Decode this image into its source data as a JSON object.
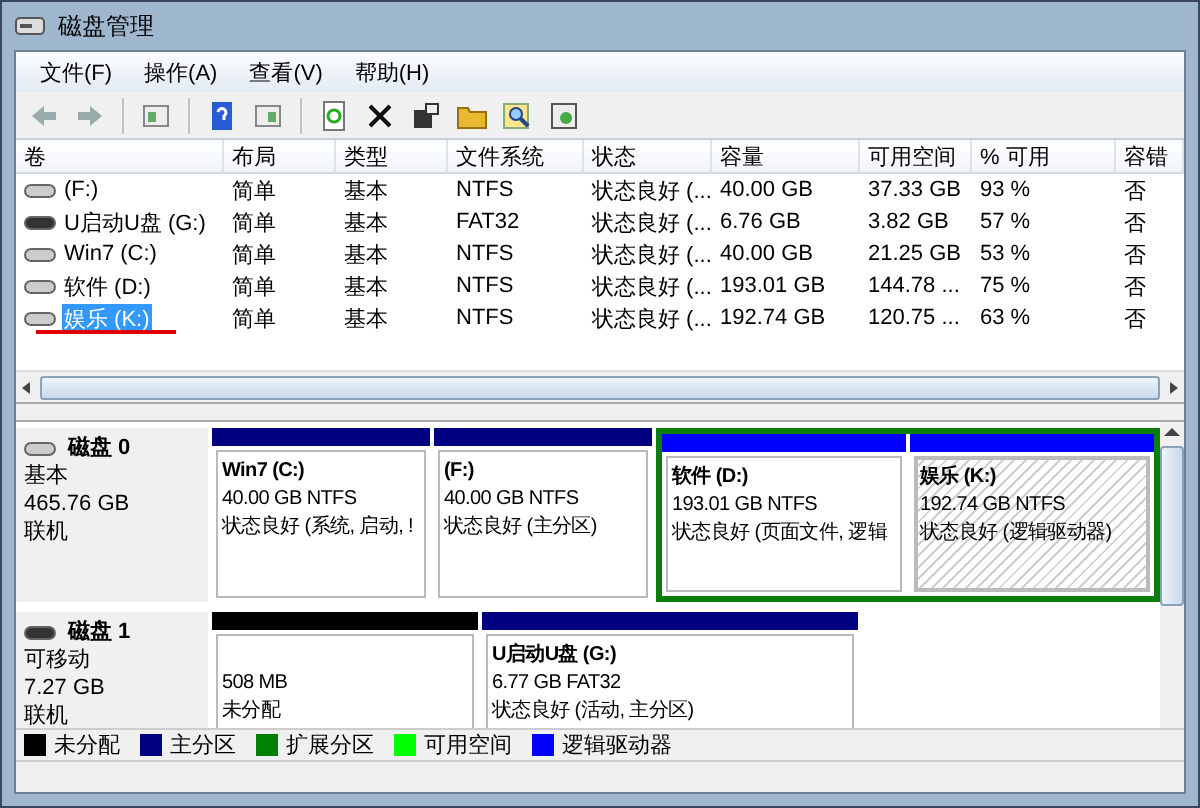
{
  "window": {
    "title": "磁盘管理"
  },
  "menu": [
    "文件(F)",
    "操作(A)",
    "查看(V)",
    "帮助(H)"
  ],
  "columns": [
    "卷",
    "布局",
    "类型",
    "文件系统",
    "状态",
    "容量",
    "可用空间",
    "% 可用",
    "容错"
  ],
  "volumes": [
    {
      "cells": [
        "(F:)",
        "简单",
        "基本",
        "NTFS",
        "状态良好 (...",
        "40.00 GB",
        "37.33 GB",
        "93 %",
        "否"
      ],
      "kind": "disk",
      "selected": false,
      "underlined": false
    },
    {
      "cells": [
        "U启动U盘 (G:)",
        "简单",
        "基本",
        "FAT32",
        "状态良好 (...",
        "6.76 GB",
        "3.82 GB",
        "57 %",
        "否"
      ],
      "kind": "usb",
      "selected": false,
      "underlined": false
    },
    {
      "cells": [
        "Win7 (C:)",
        "简单",
        "基本",
        "NTFS",
        "状态良好 (...",
        "40.00 GB",
        "21.25 GB",
        "53 %",
        "否"
      ],
      "kind": "disk",
      "selected": false,
      "underlined": false
    },
    {
      "cells": [
        "软件 (D:)",
        "简单",
        "基本",
        "NTFS",
        "状态良好 (...",
        "193.01 GB",
        "144.78 ...",
        "75 %",
        "否"
      ],
      "kind": "disk",
      "selected": false,
      "underlined": false
    },
    {
      "cells": [
        "娱乐 (K:)",
        "简单",
        "基本",
        "NTFS",
        "状态良好 (...",
        "192.74 GB",
        "120.75 ...",
        "63 %",
        "否"
      ],
      "kind": "disk",
      "selected": true,
      "underlined": true
    }
  ],
  "disks": [
    {
      "name": "磁盘 0",
      "type": "基本",
      "size": "465.76 GB",
      "status": "联机",
      "kind": "disk",
      "partitions": [
        {
          "kind": "primary",
          "name": "Win7  (C:)",
          "size": "40.00 GB NTFS",
          "status": "状态良好 (系统, 启动, !",
          "selected": false
        },
        {
          "kind": "primary",
          "name": "(F:)",
          "size": "40.00 GB NTFS",
          "status": "状态良好 (主分区)",
          "selected": false
        },
        {
          "kind": "extended",
          "children": [
            {
              "kind": "logical",
              "name": "软件  (D:)",
              "size": "193.01 GB NTFS",
              "status": "状态良好 (页面文件, 逻辑",
              "selected": false
            },
            {
              "kind": "logical",
              "name": "娱乐  (K:)",
              "size": "192.74 GB NTFS",
              "status": "状态良好 (逻辑驱动器)",
              "selected": true
            }
          ]
        }
      ]
    },
    {
      "name": "磁盘 1",
      "type": "可移动",
      "size": "7.27 GB",
      "status": "联机",
      "kind": "usb",
      "partitions": [
        {
          "kind": "unallocated",
          "size": "508 MB",
          "status": "未分配",
          "selected": false
        },
        {
          "kind": "primary",
          "name": "U启动U盘  (G:)",
          "size": "6.77 GB FAT32",
          "status": "状态良好 (活动, 主分区)",
          "selected": false
        }
      ]
    }
  ],
  "legend": [
    {
      "label": "未分配",
      "color": "#000000"
    },
    {
      "label": "主分区",
      "color": "#000080"
    },
    {
      "label": "扩展分区",
      "color": "#008000"
    },
    {
      "label": "可用空间",
      "color": "#00ff00"
    },
    {
      "label": "逻辑驱动器",
      "color": "#0000ff"
    }
  ]
}
